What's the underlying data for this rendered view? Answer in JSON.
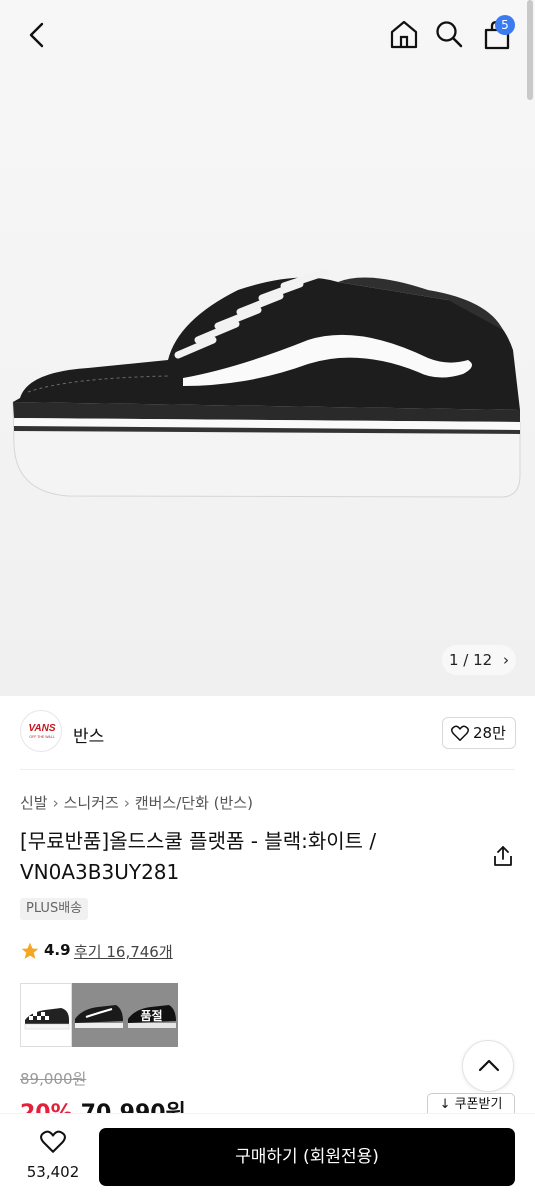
{
  "header": {
    "cart_count": "5",
    "icons": [
      "back-arrow-icon",
      "home-icon",
      "search-icon",
      "shopping-bag-icon"
    ]
  },
  "gallery": {
    "counter": "1 / 12"
  },
  "brand": {
    "name": "반스",
    "logo_text": "VANS",
    "logo_tagline": "OFF THE WALL",
    "likes": "28만"
  },
  "breadcrumb": [
    "신발",
    "스니커즈",
    "캔버스/단화 (반스)"
  ],
  "product": {
    "title": "[무료반품]올드스쿨 플랫폼 - 블랙:화이트 / VN0A3B3UY281",
    "badge": "PLUS배송",
    "rating": "4.9",
    "reviews": "후기 16,746개",
    "swatches": [
      {
        "label": ""
      },
      {
        "label": ""
      },
      {
        "label": "품절"
      }
    ]
  },
  "price": {
    "original": "89,000원",
    "discount": "20%",
    "sale": "70,990원",
    "coupon": "↓ 쿠폰받기"
  },
  "bottom": {
    "wish_count": "53,402",
    "buy_label": "구매하기 (회원전용)"
  },
  "colors": {
    "accent_badge": "#3a7bf2",
    "discount": "#e3213a",
    "star": "#f5a623"
  }
}
